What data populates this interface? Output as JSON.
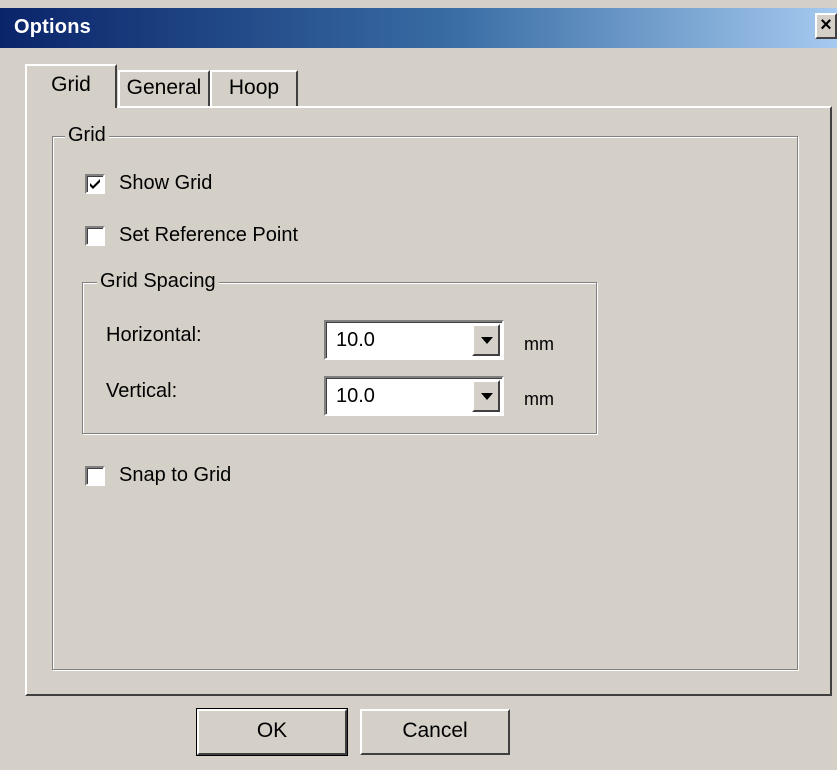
{
  "window": {
    "title": "Options",
    "close_icon": "close-icon",
    "close_label": "×"
  },
  "tabs": [
    {
      "label": "Grid",
      "active": true
    },
    {
      "label": "General",
      "active": false
    },
    {
      "label": "Hoop",
      "active": false
    }
  ],
  "grid_group": {
    "legend": "Grid",
    "show_grid": {
      "label": "Show Grid",
      "checked": true
    },
    "set_reference_point": {
      "label": "Set Reference Point",
      "checked": false
    },
    "spacing_group": {
      "legend": "Grid Spacing",
      "horizontal": {
        "label": "Horizontal:",
        "value": "10.0",
        "unit": "mm"
      },
      "vertical": {
        "label": "Vertical:",
        "value": "10.0",
        "unit": "mm"
      }
    },
    "snap_to_grid": {
      "label": "Snap to Grid",
      "checked": false
    }
  },
  "buttons": {
    "ok": "OK",
    "cancel": "Cancel"
  },
  "colors": {
    "face": "#d4d0c8",
    "title_start": "#0a246a",
    "title_end": "#a6caf0"
  }
}
